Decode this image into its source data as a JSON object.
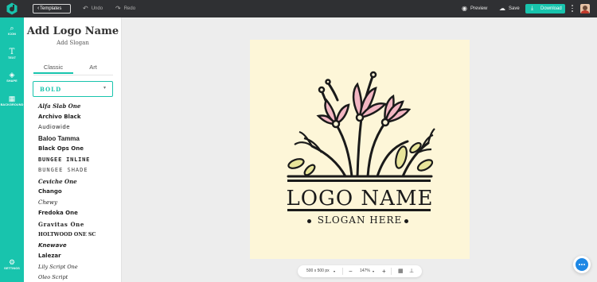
{
  "colors": {
    "accent": "#18c4ad",
    "topbar": "#2f3033",
    "artboard": "#fdf6d8",
    "petal": "#f2b6c2",
    "leaf": "#e8e59a",
    "chat": "#1e88e5"
  },
  "topbar": {
    "templates_label": "Templates",
    "undo_label": "Undo",
    "redo_label": "Redo",
    "preview_label": "Preview",
    "save_label": "Save",
    "download_label": "Download"
  },
  "rail": {
    "items": [
      {
        "label": "ICON",
        "icon": "search-icon"
      },
      {
        "label": "TEXT",
        "icon": "text-icon"
      },
      {
        "label": "SHAPE",
        "icon": "shapes-icon"
      },
      {
        "label": "BACKGROUND",
        "icon": "pattern-icon"
      },
      {
        "label": "SETTINGS",
        "icon": "gear-icon"
      }
    ]
  },
  "panel": {
    "title": "Add Logo Name",
    "slogan": "Add Slogan",
    "tabs": [
      {
        "label": "Classic",
        "active": true
      },
      {
        "label": "Art",
        "active": false
      }
    ],
    "category_selected": "BOLD",
    "fonts": [
      "Alfa Slab One",
      "Archivo Black",
      "Audiowide",
      "Baloo Tamma",
      "Black Ops One",
      "BUNGEE INLINE",
      "BUNGEE SHADE",
      "Ceviche One",
      "Chango",
      "Chewy",
      "Fredoka One",
      "Gravitas One",
      "HOLTWOOD ONE SC",
      "Knewave",
      "Lalezar",
      "Lily Script One",
      "Oleo Script"
    ]
  },
  "canvas": {
    "logo_name": "LOGO NAME",
    "slogan": "SLOGAN HERE"
  },
  "zoombar": {
    "size_label": "500 x 500 px",
    "zoom_label": "147%"
  }
}
